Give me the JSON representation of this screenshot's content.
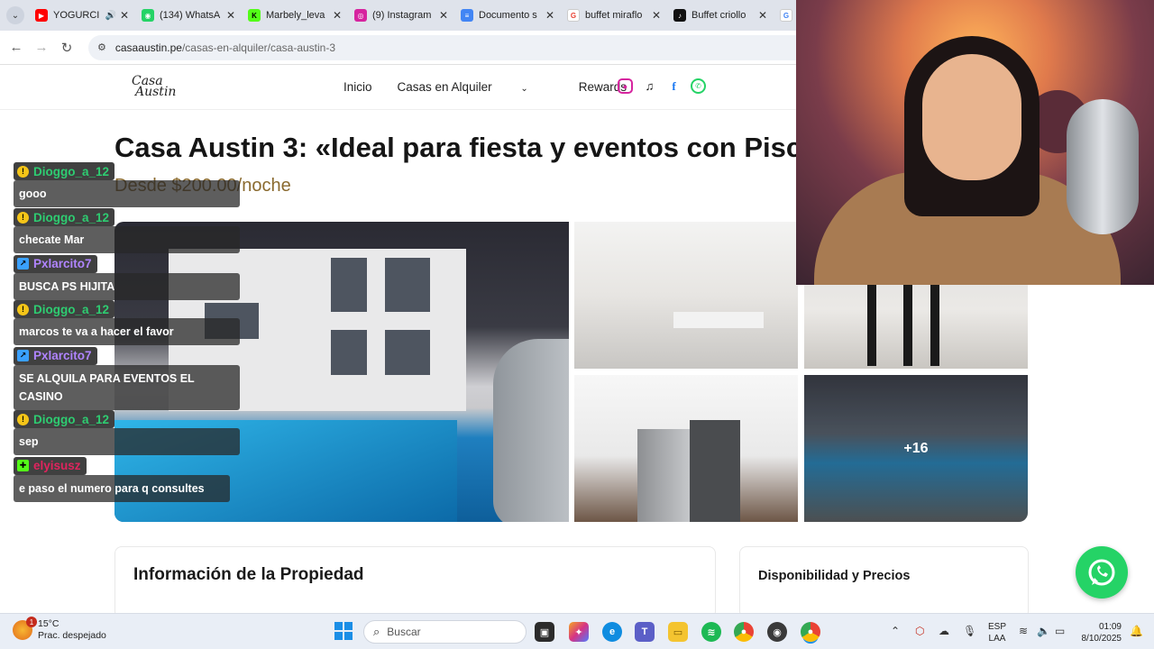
{
  "browser": {
    "tabs": [
      {
        "title": "YOGURCI",
        "icon": "youtube-icon",
        "color": "#ff0000",
        "audio": true
      },
      {
        "title": "(134) WhatsA",
        "icon": "whatsapp-icon",
        "color": "#25d366"
      },
      {
        "title": "Marbely_leva",
        "icon": "kick-icon",
        "color": "#53fc18"
      },
      {
        "title": "(9) Instagram",
        "icon": "instagram-icon",
        "color": "#d6249f"
      },
      {
        "title": "Documento s",
        "icon": "docs-icon",
        "color": "#4285f4"
      },
      {
        "title": "buffet miraflo",
        "icon": "google-icon",
        "color": "#ea4335"
      },
      {
        "title": "Buffet criollo",
        "icon": "tiktok-icon",
        "color": "#111111"
      }
    ],
    "url_domain": "casaaustin.pe",
    "url_path": "/casas-en-alquiler/casa-austin-3"
  },
  "site": {
    "logo_line1": "Casa",
    "logo_line2": "Austin",
    "nav": {
      "home": "Inicio",
      "rentals": "Casas en Alquiler",
      "rewards": "Rewards"
    }
  },
  "property": {
    "title": "Casa Austin 3: «Ideal para fiesta y eventos con Piscina",
    "price": "Desde $200.00/noche",
    "more_photos": "+16",
    "info_heading": "Información de la Propiedad",
    "availability_heading": "Disponibilidad y Precios"
  },
  "chat": [
    {
      "user": "Dioggo_a_12",
      "user_color": "#2ecc71",
      "badge_color": "#f5c518",
      "text": "gooo"
    },
    {
      "user": "Dioggo_a_12",
      "user_color": "#2ecc71",
      "badge_color": "#f5c518",
      "text": "checate Mar"
    },
    {
      "user": "Pxlarcito7",
      "user_color": "#b084ff",
      "badge_color": "#3aa0ff",
      "text": "BUSCA PS HIJITA"
    },
    {
      "user": "Dioggo_a_12",
      "user_color": "#2ecc71",
      "badge_color": "#f5c518",
      "text": "marcos te va a hacer el favor"
    },
    {
      "user": "Pxlarcito7",
      "user_color": "#b084ff",
      "badge_color": "#3aa0ff",
      "text": "SE ALQUILA PARA EVENTOS EL CASINO"
    },
    {
      "user": "Dioggo_a_12",
      "user_color": "#2ecc71",
      "badge_color": "#f5c518",
      "text": "sep"
    },
    {
      "user": "elyisusz",
      "user_color": "#e0245e",
      "badge_color": "#53fc18",
      "text": "e paso el numero para q consultes"
    }
  ],
  "taskbar": {
    "temperature": "15°C",
    "weather": "Prac. despejado",
    "weather_badge": "1",
    "search_placeholder": "Buscar",
    "lang_line1": "ESP",
    "lang_line2": "LAA",
    "time": "01:09",
    "date": "8/10/2025"
  }
}
